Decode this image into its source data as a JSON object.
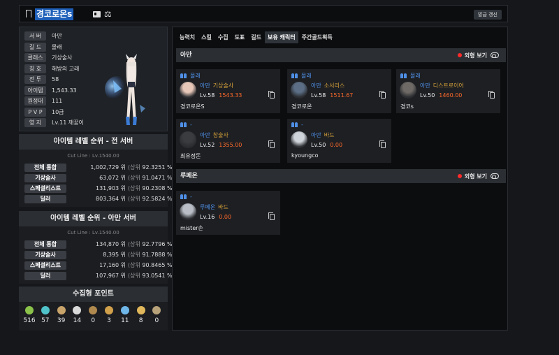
{
  "header": {
    "name": "경코로온s",
    "refresh_label": "발급 갱신"
  },
  "profile": {
    "rows": [
      {
        "key": "서 버",
        "val": "아만"
      },
      {
        "key": "길 드",
        "val": "몰래"
      },
      {
        "key": "클래스",
        "val": "기상술사"
      },
      {
        "key": "칭 호",
        "val": "해방의 고래"
      },
      {
        "key": "전 투",
        "val": "58"
      },
      {
        "key": "아이템",
        "val": "1,543.33"
      },
      {
        "key": "원정대",
        "val": "111"
      },
      {
        "key": "P V P",
        "val": "10급"
      },
      {
        "key": "영 지",
        "val": "Lv.11 깨꿍이"
      }
    ]
  },
  "rank_all": {
    "title": "아이템 레벨 순위 - 전 서버",
    "cutline": "Cut Line : Lv.1540.00",
    "rows": [
      {
        "cat": "전체 통합",
        "rank": "1,002,729 위",
        "sub": "(상위",
        "pct": "92.3251 %)"
      },
      {
        "cat": "기상술사",
        "rank": "63,072 위",
        "sub": "(상위",
        "pct": "91.0471 %)"
      },
      {
        "cat": "스페셜리스트",
        "rank": "131,903 위",
        "sub": "(상위",
        "pct": "90.2308 %)"
      },
      {
        "cat": "딜러",
        "rank": "803,364 위",
        "sub": "(상위",
        "pct": "92.5824 %)"
      }
    ]
  },
  "rank_server": {
    "title": "아이템 레벨 순위 - 아만 서버",
    "cutline": "Cut Line : Lv.1540.00",
    "rows": [
      {
        "cat": "전체 통합",
        "rank": "134,870 위",
        "sub": "(상위",
        "pct": "92.7796 %)"
      },
      {
        "cat": "기상술사",
        "rank": "8,395 위",
        "sub": "(상위",
        "pct": "91.7888 %)"
      },
      {
        "cat": "스페셜리스트",
        "rank": "17,160 위",
        "sub": "(상위",
        "pct": "90.8465 %)"
      },
      {
        "cat": "딜러",
        "rank": "107,967 위",
        "sub": "(상위",
        "pct": "93.0541 %)"
      }
    ]
  },
  "collect": {
    "title": "수집형 포인트",
    "items": [
      {
        "icon": "seed-icon",
        "color": "#8bc34a",
        "num": "516"
      },
      {
        "icon": "island-icon",
        "color": "#4fc3c9",
        "num": "57"
      },
      {
        "icon": "painting-icon",
        "color": "#c9a46a",
        "num": "39"
      },
      {
        "icon": "giant-heart-icon",
        "color": "#d9d9d9",
        "num": "14"
      },
      {
        "icon": "masterpiece-icon",
        "color": "#b0894f",
        "num": "0"
      },
      {
        "icon": "voyage-icon",
        "color": "#d1a04a",
        "num": "3"
      },
      {
        "icon": "star-icon",
        "color": "#6fb7e9",
        "num": "11"
      },
      {
        "icon": "world-tree-icon",
        "color": "#e0b75a",
        "num": "8"
      },
      {
        "icon": "orpheus-icon",
        "color": "#b7a27a",
        "num": "0"
      }
    ]
  },
  "tabs": [
    "능력치",
    "스킬",
    "수집",
    "도표",
    "길드",
    "보유 캐릭터",
    "주간골드획득"
  ],
  "active_tab": 5,
  "servers": [
    {
      "name": "아만",
      "toggle_label": "외형 보기",
      "chars": [
        {
          "guild": "몰래",
          "server": "아만",
          "cls": "기상술사",
          "lv": "Lv.58",
          "il": "1543.33",
          "name": "경코로온S",
          "av": "#e7c7b8"
        },
        {
          "guild": "몰래",
          "server": "아만",
          "cls": "소서리스",
          "lv": "Lv.58",
          "il": "1511.67",
          "name": "경코로온",
          "av": "#5b6e85"
        },
        {
          "guild": "몰래",
          "server": "아만",
          "cls": "디스트로이어",
          "lv": "Lv.50",
          "il": "1460.00",
          "name": "경코s",
          "av": "#6f6a66"
        },
        {
          "guild": "-",
          "server": "아만",
          "cls": "창술사",
          "lv": "Lv.52",
          "il": "1355.00",
          "name": "최유정돈",
          "av": "#3a3c40"
        },
        {
          "guild": "-",
          "server": "아만",
          "cls": "바드",
          "lv": "Lv.50",
          "il": "0.00",
          "name": "kyoungco",
          "av": "#cfd4da"
        }
      ]
    },
    {
      "name": "루페온",
      "toggle_label": "외형 보기",
      "chars": [
        {
          "guild": "-",
          "server": "루페온",
          "cls": "바드",
          "lv": "Lv.16",
          "il": "0.00",
          "name": "mister손",
          "av": "#b9bec6"
        }
      ]
    }
  ]
}
